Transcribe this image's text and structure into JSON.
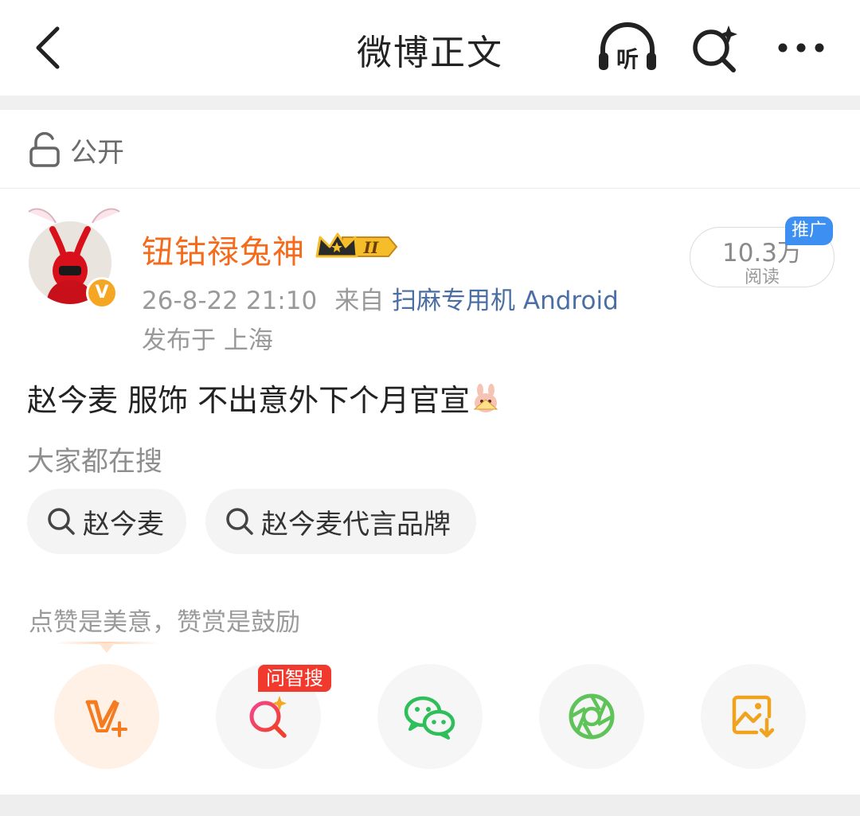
{
  "header": {
    "title": "微博正文",
    "listen_icon": "listen-headphone-icon",
    "search_icon": "ai-search-icon",
    "more_icon": "more-dots-icon"
  },
  "visibility": {
    "label": "公开",
    "icon": "lock-open-icon"
  },
  "author": {
    "name": "钮钴禄兔神",
    "name_color": "#f56a1b",
    "level_badge": "II",
    "verified_badge": "V",
    "timestamp": "26-8-22 21:10",
    "source_prefix": "来自",
    "source": "扫麻专用机 Android",
    "location": "发布于 上海"
  },
  "reads": {
    "count": "10.3万",
    "label": "阅读",
    "promo_tag": "推广"
  },
  "post": {
    "text": "赵今麦  服饰 不出意外下个月官宣"
  },
  "search_section": {
    "title": "大家都在搜",
    "chips": [
      "赵今麦",
      "赵今麦代言品牌"
    ]
  },
  "tip": {
    "text": "点赞是美意，赞赏是鼓励"
  },
  "actions": {
    "ask_badge": "问智搜",
    "items": [
      "vip-plus-icon",
      "ai-search-icon",
      "wechat-icon",
      "moments-icon",
      "save-image-icon"
    ]
  },
  "colors": {
    "accent": "#f56a1b",
    "link": "#4b6fa5",
    "promo": "#3d8ff2",
    "badge_red": "#f13a2d"
  }
}
